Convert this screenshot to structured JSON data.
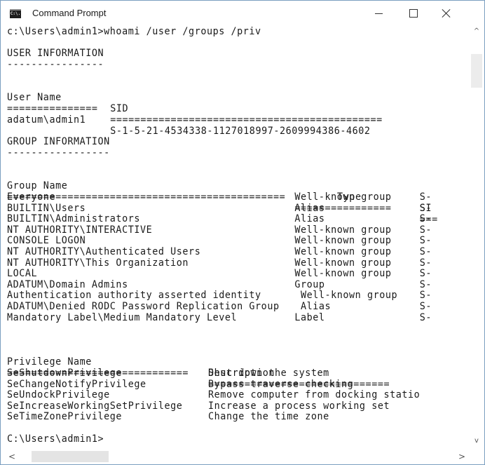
{
  "window": {
    "title": "Command Prompt",
    "icon": "cmd-icon",
    "icon_label": "C:\\."
  },
  "console": {
    "command_line": "c:\\Users\\admin1>whoami /user /groups /priv",
    "user_section": {
      "heading": "USER INFORMATION",
      "underline": "----------------",
      "headers": {
        "user_name": "User Name",
        "sid": "SID"
      },
      "separators": {
        "user_name": "===============",
        "sid": "============================================="
      },
      "row": {
        "user_name": "adatum\\admin1",
        "sid": "S-1-5-21-4534338-1127018997-2609994386-4602"
      }
    },
    "group_section": {
      "heading": "GROUP INFORMATION",
      "underline": "-----------------",
      "headers": {
        "group_name": "Group Name",
        "type": "Type",
        "sid": "SI"
      },
      "separators": {
        "group_name": "==============================================",
        "type": "================",
        "sid": "==="
      },
      "rows": [
        {
          "group_name": "Everyone",
          "type": "Well-known group",
          "sid": "S-"
        },
        {
          "group_name": "BUILTIN\\Users",
          "type": "Alias",
          "sid": "S-"
        },
        {
          "group_name": "BUILTIN\\Administrators",
          "type": "Alias",
          "sid": "S-"
        },
        {
          "group_name": "NT AUTHORITY\\INTERACTIVE",
          "type": "Well-known group",
          "sid": "S-"
        },
        {
          "group_name": "CONSOLE LOGON",
          "type": "Well-known group",
          "sid": "S-"
        },
        {
          "group_name": "NT AUTHORITY\\Authenticated Users",
          "type": "Well-known group",
          "sid": "S-"
        },
        {
          "group_name": "NT AUTHORITY\\This Organization",
          "type": "Well-known group",
          "sid": "S-"
        },
        {
          "group_name": "LOCAL",
          "type": "Well-known group",
          "sid": "S-"
        },
        {
          "group_name": "ADATUM\\Domain Admins",
          "type": "Group",
          "sid": "S-"
        },
        {
          "group_name": "Authentication authority asserted identity",
          "type": " Well-known group",
          "sid": "S-"
        },
        {
          "group_name": "ADATUM\\Denied RODC Password Replication Group",
          "type": " Alias",
          "sid": "S-"
        },
        {
          "group_name": "Mandatory Label\\Medium Mandatory Level",
          "type": "Label",
          "sid": "S-"
        }
      ]
    },
    "privilege_section": {
      "headers": {
        "name": "Privilege Name",
        "description": "Description"
      },
      "separators": {
        "name": "==============================",
        "description": "=============================="
      },
      "rows": [
        {
          "name": "SeShutdownPrivilege",
          "description": "Shut down the system"
        },
        {
          "name": "SeChangeNotifyPrivilege",
          "description": "Bypass traverse checking"
        },
        {
          "name": "SeUndockPrivilege",
          "description": "Remove computer from docking statio"
        },
        {
          "name": "SeIncreaseWorkingSetPrivilege",
          "description": "Increase a process working set"
        },
        {
          "name": "SeTimeZonePrivilege",
          "description": "Change the time zone"
        }
      ]
    },
    "prompt": "C:\\Users\\admin1>"
  },
  "scrollbars": {
    "up_arrow": "^",
    "down_arrow": "v",
    "left_arrow": "<",
    "right_arrow": ">"
  },
  "colors": {
    "window_border": "#7a9fc0",
    "text": "#1a1a1a",
    "background": "#ffffff"
  }
}
